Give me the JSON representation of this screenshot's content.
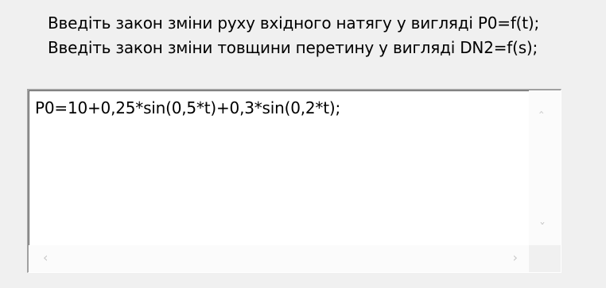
{
  "instructions": {
    "line1": "Введіть закон зміни руху вхідного натягу у вигляді P0=f(t);",
    "line2": "Введіть закон зміни товщини перетину у вигляді DN2=f(s);"
  },
  "memo": {
    "content": "P0=10+0,25*sin(0,5*t)+0,3*sin(0,2*t);"
  },
  "icons": {
    "up": "‸",
    "down": "ˇ",
    "left": "‹",
    "right": "›"
  }
}
